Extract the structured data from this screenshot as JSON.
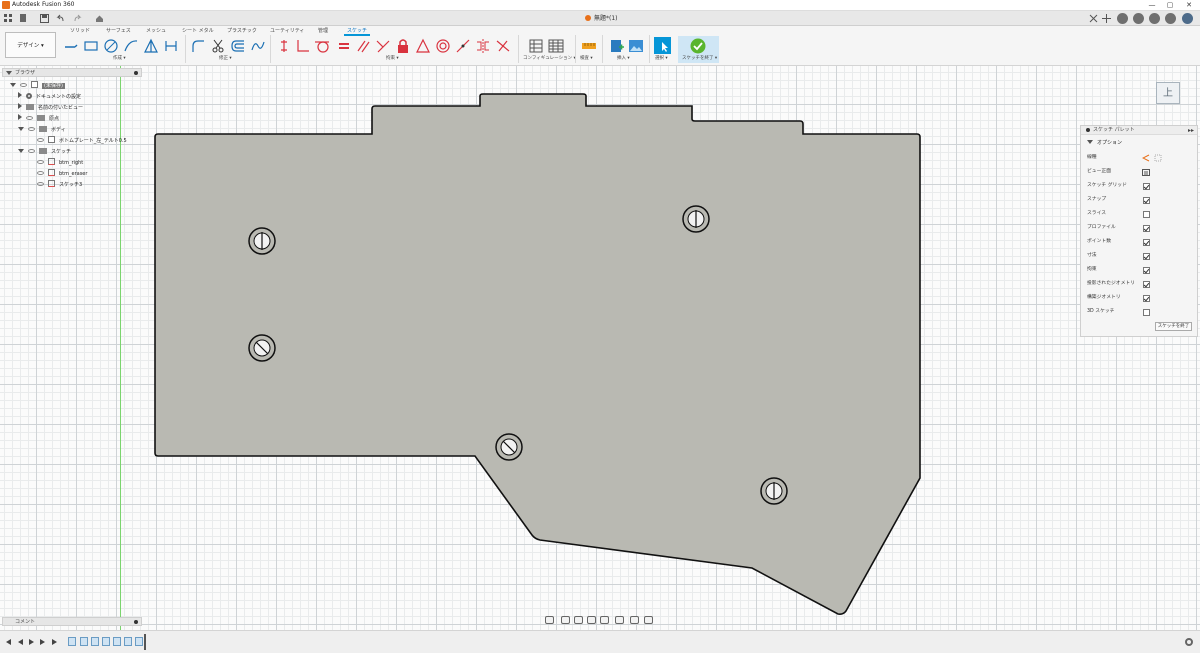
{
  "app": {
    "title": "Autodesk Fusion 360"
  },
  "window_controls": {
    "minimize": "—",
    "maximize": "▢",
    "close": "✕"
  },
  "document": {
    "tab_title": "無題*(1)"
  },
  "ribbon": {
    "workspace_label": "デザイン ▾",
    "tabs": [
      "ソリッド",
      "サーフェス",
      "メッシュ",
      "シート メタル",
      "プラスチック",
      "ユーティリティ",
      "管理",
      "スケッチ"
    ],
    "active_tab": "スケッチ",
    "groups": {
      "create": "作成 ▾",
      "modify": "修正 ▾",
      "constraints": "拘束 ▾",
      "configure": "コンフィギュレーション ▾",
      "inspect": "検査 ▾",
      "insert": "挿入 ▾",
      "select": "選択 ▾",
      "finish": "スケッチを終了 ▾"
    }
  },
  "browser": {
    "title": "ブラウザ",
    "root": "(未保存)",
    "items": [
      {
        "label": "ドキュメントの設定"
      },
      {
        "label": "名前の付いたビュー"
      },
      {
        "label": "原点"
      },
      {
        "label": "ボディ"
      },
      {
        "label": "ボトムプレート_左_テルト0.5"
      },
      {
        "label": "スケッチ"
      },
      {
        "label": "btm_right"
      },
      {
        "label": "btm_eraser"
      },
      {
        "label": "スケッチ3"
      }
    ]
  },
  "viewcube": {
    "face_label": "上"
  },
  "sketch_palette": {
    "title": "スケッチ パレット",
    "section": "オプション",
    "options": [
      {
        "label": "線種",
        "checked": null
      },
      {
        "label": "ビュー正面",
        "checked": null
      },
      {
        "label": "スケッチ グリッド",
        "checked": true
      },
      {
        "label": "スナップ",
        "checked": true
      },
      {
        "label": "スライス",
        "checked": false
      },
      {
        "label": "プロファイル",
        "checked": true
      },
      {
        "label": "ポイント数",
        "checked": true
      },
      {
        "label": "寸法",
        "checked": true
      },
      {
        "label": "拘束",
        "checked": true
      },
      {
        "label": "投影されたジオメトリ",
        "checked": true
      },
      {
        "label": "構築ジオメトリ",
        "checked": true
      },
      {
        "label": "3D スケッチ",
        "checked": false
      }
    ],
    "finish_button": "スケッチを終了"
  },
  "comments": {
    "title": "コメント"
  },
  "colors": {
    "accent": "#0696d7",
    "finish_green": "#59b52e",
    "plate_fill": "#b9b9b2",
    "sketch_red": "#d9333f",
    "axis_green": "#7bd46e"
  }
}
